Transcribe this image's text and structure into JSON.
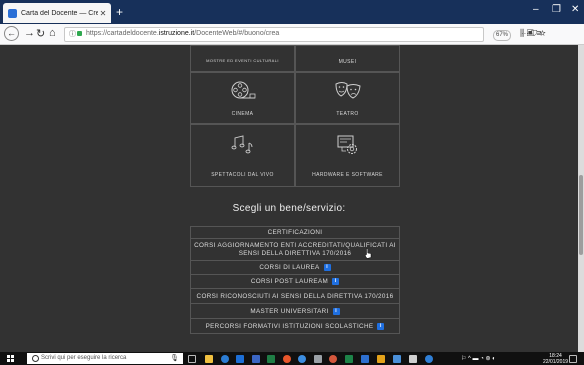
{
  "browser": {
    "tab_title": "Carta del Docente — Crea buo",
    "tab_close": "✕",
    "new_tab": "+",
    "url_prefix": "https://cartadeldocente.",
    "url_domain": "istruzione.it",
    "url_path": "/DocenteWeb/#/buono/crea",
    "zoom": "67%",
    "url_icons": "··· ⛉ ☆",
    "toolbar_icons": "⫼ ▣ ≡",
    "window_controls": {
      "minimize": "–",
      "maximize": "❐",
      "close": "✕"
    }
  },
  "categories": [
    {
      "label": "MOSTRE ED EVENTI CULTURALI",
      "icon": "exhibition-icon"
    },
    {
      "label": "MUSEI",
      "icon": "museum-icon"
    },
    {
      "label": "CINEMA",
      "icon": "film-reel-icon"
    },
    {
      "label": "TEATRO",
      "icon": "theater-masks-icon"
    },
    {
      "label": "SPETTACOLI DAL VIVO",
      "icon": "music-notes-icon"
    },
    {
      "label": "HARDWARE E SOFTWARE",
      "icon": "hardware-software-icon"
    }
  ],
  "services": {
    "title": "Scegli un bene/servizio:",
    "badge": "i",
    "items": [
      {
        "label": "CERTIFICAZIONI",
        "info": false
      },
      {
        "label": "CORSI AGGIORNAMENTO ENTI ACCREDITATI/QUALIFICATI AI SENSI DELLA DIRETTIVA 170/2016",
        "info": false
      },
      {
        "label": "CORSI DI LAUREA",
        "info": true
      },
      {
        "label": "CORSI POST LAUREAM",
        "info": true
      },
      {
        "label": "CORSI RICONOSCIUTI AI SENSI DELLA DIRETTIVA 170/2016",
        "info": false
      },
      {
        "label": "MASTER UNIVERSITARI",
        "info": true
      },
      {
        "label": "PERCORSI FORMATIVI ISTITUZIONI SCOLASTICHE",
        "info": true
      }
    ]
  },
  "taskbar": {
    "search_placeholder": "Scrivi qui per eseguire la ricerca",
    "time": "18:24",
    "date": "22/01/2019"
  },
  "colors": {
    "page_bg": "#323232",
    "info_badge": "#1f6fe0",
    "tab_strip": "#17305a"
  }
}
